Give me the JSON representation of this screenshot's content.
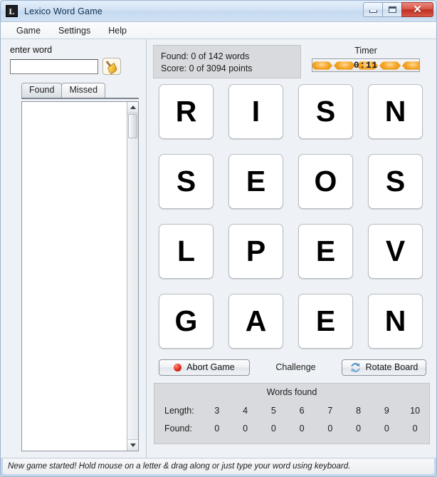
{
  "window": {
    "title": "Lexico Word Game",
    "app_icon": "lexico-icon",
    "minimize_label": "Minimize",
    "maximize_label": "Maximize",
    "close_label": "Close"
  },
  "menubar": {
    "items": [
      {
        "label": "Game"
      },
      {
        "label": "Settings"
      },
      {
        "label": "Help"
      }
    ]
  },
  "left_panel": {
    "enter_word_label": "enter word",
    "word_input_value": "",
    "word_input_placeholder": "",
    "clear_icon": "broom-icon",
    "tabs": [
      {
        "label": "Found",
        "active": true
      },
      {
        "label": "Missed",
        "active": false
      }
    ],
    "found_list_items": []
  },
  "stats": {
    "found_line": "Found: 0 of 142 words",
    "score_line": "Score: 0 of 3094 points",
    "found_count": 0,
    "found_total": 142,
    "score": 0,
    "score_total": 3094
  },
  "timer": {
    "label": "Timer",
    "value": "0:11",
    "bead_color": "#f5a623"
  },
  "board": {
    "rows": [
      [
        "R",
        "I",
        "S",
        "N"
      ],
      [
        "S",
        "E",
        "O",
        "S"
      ],
      [
        "L",
        "P",
        "E",
        "V"
      ],
      [
        "G",
        "A",
        "E",
        "N"
      ]
    ]
  },
  "actions": {
    "abort_label": "Abort Game",
    "abort_icon": "red-circle-icon",
    "challenge_label": "Challenge",
    "rotate_label": "Rotate Board",
    "rotate_icon": "rotate-refresh-icon"
  },
  "words_found": {
    "title": "Words found",
    "length_header": "Length:",
    "found_header": "Found:",
    "lengths": [
      "3",
      "4",
      "5",
      "6",
      "7",
      "8",
      "9",
      "10"
    ],
    "counts": [
      "0",
      "0",
      "0",
      "0",
      "0",
      "0",
      "0",
      "0"
    ]
  },
  "statusbar": {
    "message": "New game started! Hold mouse on a letter & drag along or just type your word using keyboard."
  },
  "colors": {
    "accent_orange": "#f5a623",
    "close_red": "#bf2f20",
    "panel_gray": "#d8dadd",
    "window_blue": "#cadcef"
  }
}
